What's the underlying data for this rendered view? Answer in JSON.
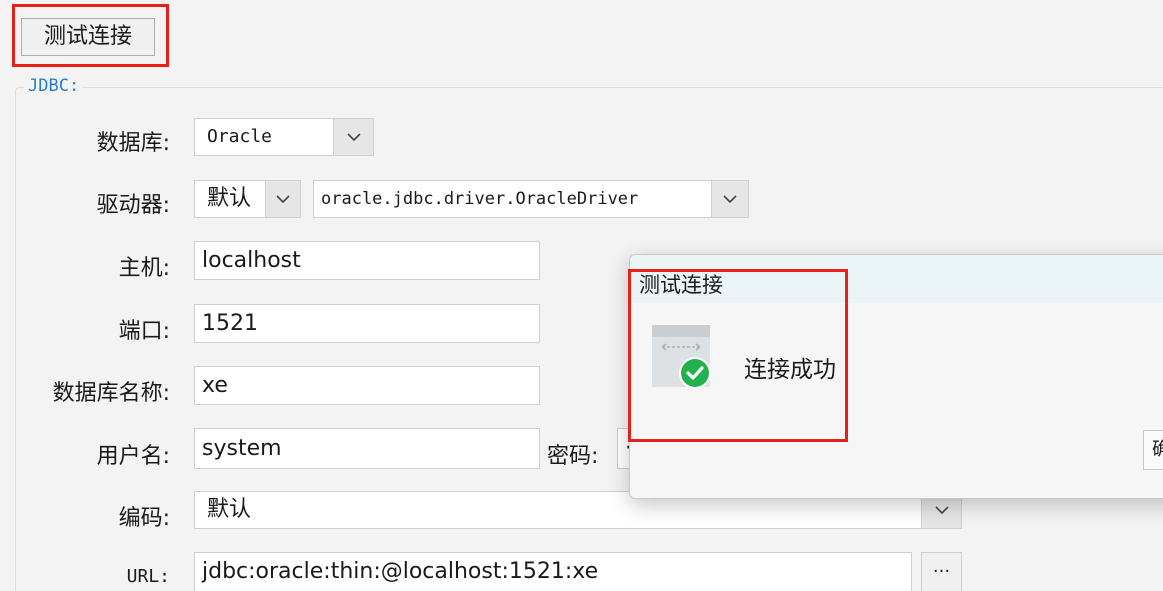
{
  "toolbar": {
    "test_connection_label": "测试连接"
  },
  "group": {
    "title": "JDBC:"
  },
  "form": {
    "database": {
      "label": "数据库:",
      "value": "Oracle"
    },
    "driver": {
      "label": "驱动器:",
      "mode_value": "默认",
      "class_value": "oracle.jdbc.driver.OracleDriver"
    },
    "host": {
      "label": "主机:",
      "value": "localhost"
    },
    "port": {
      "label": "端口:",
      "value": "1521"
    },
    "dbname": {
      "label": "数据库名称:",
      "value": "xe"
    },
    "username": {
      "label": "用户名:",
      "value": "system"
    },
    "password": {
      "label": "密码:",
      "value": "·"
    },
    "encoding": {
      "label": "编码:",
      "value": "默认"
    },
    "url": {
      "label": "URL:",
      "value": "jdbc:oracle:thin:@localhost:1521:xe",
      "browse_label": "···"
    }
  },
  "dialog": {
    "title": "测试连接",
    "message": "连接成功",
    "ok_label": "确"
  },
  "colors": {
    "highlight": "#e8201b",
    "group_title": "#2a7fc7",
    "success": "#23b14d",
    "titlebar": "#eaf4f7"
  }
}
